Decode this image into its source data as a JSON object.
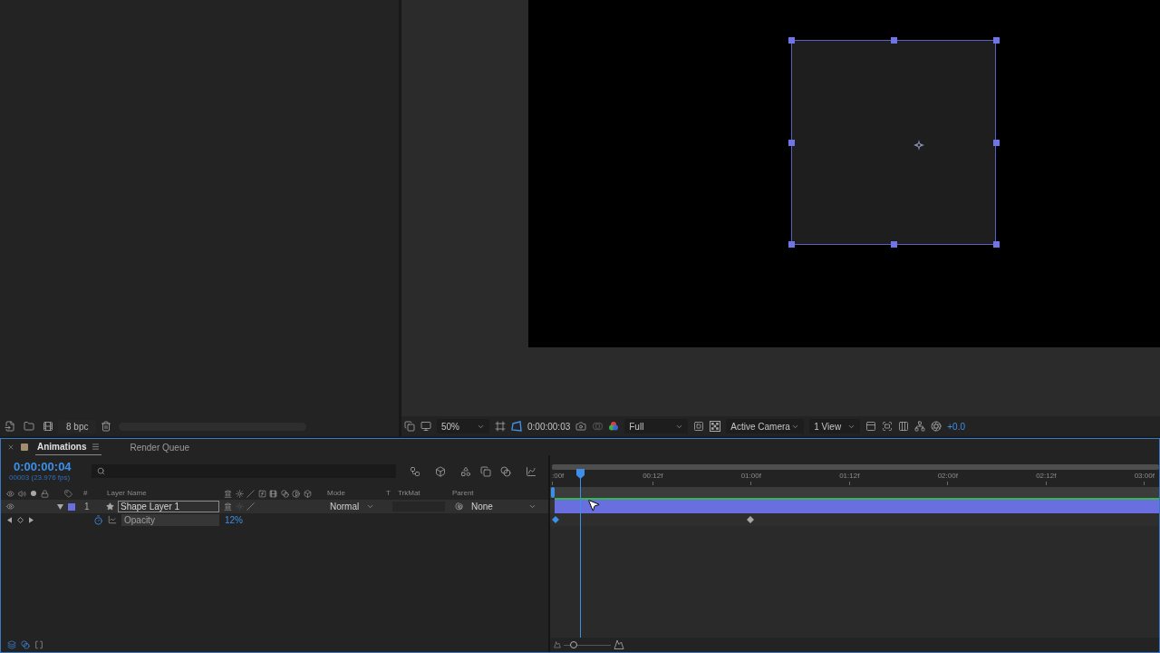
{
  "project_panel": {
    "bit_depth": "8 bpc"
  },
  "viewer": {
    "magnification": "50%",
    "current_time": "0:00:00:03",
    "resolution": "Full",
    "camera": "Active Camera",
    "layout": "1 View",
    "exposure": "+0.0"
  },
  "timeline": {
    "tabs": [
      {
        "label": "Animations",
        "selected": true,
        "color": "#a38d6d"
      },
      {
        "label": "Render Queue",
        "selected": false
      }
    ],
    "current_time": "0:00:00:04",
    "frame_info": "00003 (23.976 fps)",
    "columns": [
      "#",
      "Layer Name",
      "Mode",
      "T",
      "TrkMat",
      "Parent"
    ],
    "layers": [
      {
        "number": "1",
        "name": "Shape Layer 1",
        "color": "#6a6fe0",
        "visible": true,
        "expanded": true,
        "selected": true,
        "mode": "Normal",
        "parent": "None",
        "properties": [
          {
            "name": "Opacity",
            "value": "12%",
            "animated": true,
            "keyframes": [
              {
                "selected": true
              },
              {
                "selected": false
              }
            ]
          }
        ]
      }
    ],
    "ruler": [
      ":00f",
      "00:12f",
      "01:00f",
      "01:12f",
      "02:00f",
      "02:12f",
      "03:00f"
    ],
    "zoom_slider": {
      "level": 0.15
    }
  }
}
